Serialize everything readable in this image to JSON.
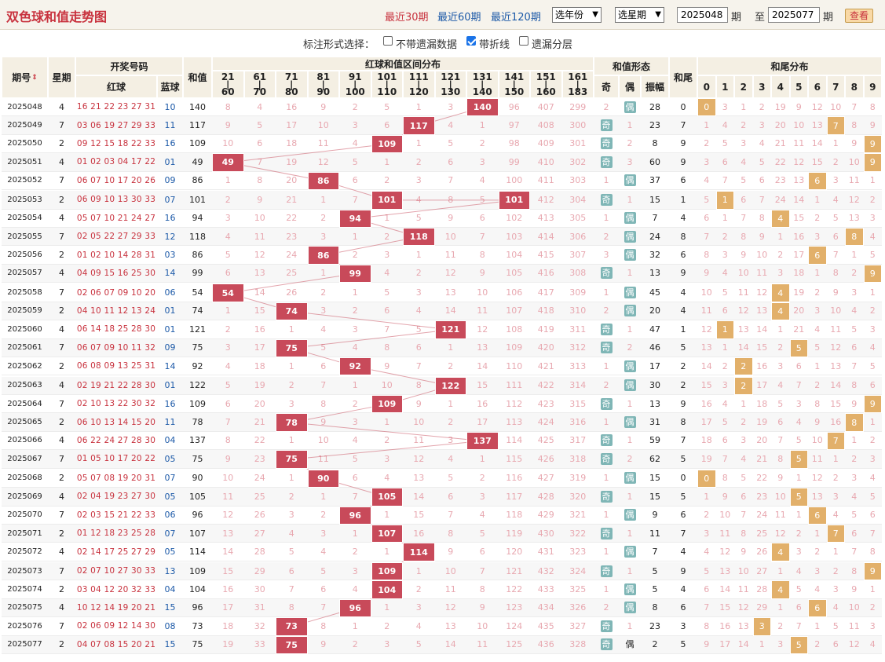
{
  "header": {
    "title": "双色球和值走势图",
    "ranges": [
      "最近30期",
      "最近60期",
      "最近120期"
    ],
    "active_range": 0,
    "year_select": "选年份",
    "week_select": "选星期",
    "from_issue": "2025048",
    "issue_unit": "期",
    "to_label": "至",
    "to_issue": "2025077",
    "view_button": "查看"
  },
  "options": {
    "label": "标注形式选择：",
    "items": [
      {
        "label": "不带遗漏数据",
        "checked": false
      },
      {
        "label": "带折线",
        "checked": true
      },
      {
        "label": "遗漏分层",
        "checked": false
      }
    ]
  },
  "columns": {
    "issue": "期号",
    "weekday": "星期",
    "draw": "开奖号码",
    "red": "红球",
    "blue": "蓝球",
    "sum": "和值",
    "zone_title": "红球和值区间分布",
    "zones": [
      [
        "21",
        "60"
      ],
      [
        "61",
        "70"
      ],
      [
        "71",
        "80"
      ],
      [
        "81",
        "90"
      ],
      [
        "91",
        "100"
      ],
      [
        "101",
        "110"
      ],
      [
        "111",
        "120"
      ],
      [
        "121",
        "130"
      ],
      [
        "131",
        "140"
      ],
      [
        "141",
        "150"
      ],
      [
        "151",
        "160"
      ],
      [
        "161",
        "183"
      ]
    ],
    "form_title": "和值形态",
    "form_cols": [
      "奇",
      "偶",
      "振幅"
    ],
    "tail": "和尾",
    "tail_title": "和尾分布",
    "tail_digits": [
      "0",
      "1",
      "2",
      "3",
      "4",
      "5",
      "6",
      "7",
      "8",
      "9"
    ]
  },
  "colors": {
    "hit": "#c84a5a",
    "tail_hit": "#e2b06a",
    "odd": "#7fb6b6",
    "even": "#7fb6b6",
    "miss": "#e8a8b0",
    "red_ball": "#c8323e",
    "blue_ball": "#1d5aa8"
  },
  "rows": [
    {
      "issue": "2025048",
      "wd": "4",
      "red": "16 21 22 23 27 31",
      "blue": "10",
      "sum": "140",
      "zones": [
        "8",
        "4",
        "16",
        "9",
        "2",
        "5",
        "1",
        "3",
        "140",
        "96",
        "407",
        "299"
      ],
      "forms": [
        "2",
        "偶",
        "28"
      ],
      "tail": "0",
      "tails": [
        "0",
        "3",
        "1",
        "2",
        "19",
        "9",
        "12",
        "10",
        "7",
        "8"
      ]
    },
    {
      "issue": "2025049",
      "wd": "7",
      "red": "03 06 19 27 29 33",
      "blue": "11",
      "sum": "117",
      "zones": [
        "9",
        "5",
        "17",
        "10",
        "3",
        "6",
        "117",
        "4",
        "1",
        "97",
        "408",
        "300"
      ],
      "forms": [
        "奇",
        "1",
        "23"
      ],
      "tail": "7",
      "tails": [
        "1",
        "4",
        "2",
        "3",
        "20",
        "10",
        "13",
        "7",
        "8",
        "9"
      ]
    },
    {
      "issue": "2025050",
      "wd": "2",
      "red": "09 12 15 18 22 33",
      "blue": "16",
      "sum": "109",
      "zones": [
        "10",
        "6",
        "18",
        "11",
        "4",
        "109",
        "1",
        "5",
        "2",
        "98",
        "409",
        "301"
      ],
      "forms": [
        "奇",
        "2",
        "8"
      ],
      "tail": "9",
      "tails": [
        "2",
        "5",
        "3",
        "4",
        "21",
        "11",
        "14",
        "1",
        "9",
        "9"
      ]
    },
    {
      "issue": "2025051",
      "wd": "4",
      "red": "01 02 03 04 17 22",
      "blue": "01",
      "sum": "49",
      "zones": [
        "49",
        "7",
        "19",
        "12",
        "5",
        "1",
        "2",
        "6",
        "3",
        "99",
        "410",
        "302"
      ],
      "forms": [
        "奇",
        "3",
        "60"
      ],
      "tail": "9",
      "tails": [
        "3",
        "6",
        "4",
        "5",
        "22",
        "12",
        "15",
        "2",
        "10",
        "9"
      ]
    },
    {
      "issue": "2025052",
      "wd": "7",
      "red": "06 07 10 17 20 26",
      "blue": "09",
      "sum": "86",
      "zones": [
        "1",
        "8",
        "20",
        "86",
        "6",
        "2",
        "3",
        "7",
        "4",
        "100",
        "411",
        "303"
      ],
      "forms": [
        "1",
        "偶",
        "37"
      ],
      "tail": "6",
      "tails": [
        "4",
        "7",
        "5",
        "6",
        "23",
        "13",
        "6",
        "3",
        "11",
        "1"
      ]
    },
    {
      "issue": "2025053",
      "wd": "2",
      "red": "06 09 10 13 30 33",
      "blue": "07",
      "sum": "101",
      "zones": [
        "2",
        "9",
        "21",
        "1",
        "7",
        "101",
        "4",
        "8",
        "5",
        "101",
        "412",
        "304"
      ],
      "forms": [
        "奇",
        "1",
        "15"
      ],
      "tail": "1",
      "tails": [
        "5",
        "1",
        "6",
        "7",
        "24",
        "14",
        "1",
        "4",
        "12",
        "2"
      ]
    },
    {
      "issue": "2025054",
      "wd": "4",
      "red": "05 07 10 21 24 27",
      "blue": "16",
      "sum": "94",
      "zones": [
        "3",
        "10",
        "22",
        "2",
        "94",
        "1",
        "5",
        "9",
        "6",
        "102",
        "413",
        "305"
      ],
      "forms": [
        "1",
        "偶",
        "7"
      ],
      "tail": "4",
      "tails": [
        "6",
        "1",
        "7",
        "8",
        "4",
        "15",
        "2",
        "5",
        "13",
        "3"
      ]
    },
    {
      "issue": "2025055",
      "wd": "7",
      "red": "02 05 22 27 29 33",
      "blue": "12",
      "sum": "118",
      "zones": [
        "4",
        "11",
        "23",
        "3",
        "1",
        "2",
        "118",
        "10",
        "7",
        "103",
        "414",
        "306"
      ],
      "forms": [
        "2",
        "偶",
        "24"
      ],
      "tail": "8",
      "tails": [
        "7",
        "2",
        "8",
        "9",
        "1",
        "16",
        "3",
        "6",
        "8",
        "4"
      ]
    },
    {
      "issue": "2025056",
      "wd": "2",
      "red": "01 02 10 14 28 31",
      "blue": "03",
      "sum": "86",
      "zones": [
        "5",
        "12",
        "24",
        "86",
        "2",
        "3",
        "1",
        "11",
        "8",
        "104",
        "415",
        "307"
      ],
      "forms": [
        "3",
        "偶",
        "32"
      ],
      "tail": "6",
      "tails": [
        "8",
        "3",
        "9",
        "10",
        "2",
        "17",
        "6",
        "7",
        "1",
        "5"
      ]
    },
    {
      "issue": "2025057",
      "wd": "4",
      "red": "04 09 15 16 25 30",
      "blue": "14",
      "sum": "99",
      "zones": [
        "6",
        "13",
        "25",
        "1",
        "99",
        "4",
        "2",
        "12",
        "9",
        "105",
        "416",
        "308"
      ],
      "forms": [
        "奇",
        "1",
        "13"
      ],
      "tail": "9",
      "tails": [
        "9",
        "4",
        "10",
        "11",
        "3",
        "18",
        "1",
        "8",
        "2",
        "9"
      ]
    },
    {
      "issue": "2025058",
      "wd": "7",
      "red": "02 06 07 09 10 20",
      "blue": "06",
      "sum": "54",
      "zones": [
        "54",
        "14",
        "26",
        "2",
        "1",
        "5",
        "3",
        "13",
        "10",
        "106",
        "417",
        "309"
      ],
      "forms": [
        "1",
        "偶",
        "45"
      ],
      "tail": "4",
      "tails": [
        "10",
        "5",
        "11",
        "12",
        "4",
        "19",
        "2",
        "9",
        "3",
        "1"
      ]
    },
    {
      "issue": "2025059",
      "wd": "2",
      "red": "04 10 11 12 13 24",
      "blue": "01",
      "sum": "74",
      "zones": [
        "1",
        "15",
        "74",
        "3",
        "2",
        "6",
        "4",
        "14",
        "11",
        "107",
        "418",
        "310"
      ],
      "forms": [
        "2",
        "偶",
        "20"
      ],
      "tail": "4",
      "tails": [
        "11",
        "6",
        "12",
        "13",
        "4",
        "20",
        "3",
        "10",
        "4",
        "2"
      ]
    },
    {
      "issue": "2025060",
      "wd": "4",
      "red": "06 14 18 25 28 30",
      "blue": "01",
      "sum": "121",
      "zones": [
        "2",
        "16",
        "1",
        "4",
        "3",
        "7",
        "5",
        "121",
        "12",
        "108",
        "419",
        "311"
      ],
      "forms": [
        "奇",
        "1",
        "47"
      ],
      "tail": "1",
      "tails": [
        "12",
        "1",
        "13",
        "14",
        "1",
        "21",
        "4",
        "11",
        "5",
        "3"
      ]
    },
    {
      "issue": "2025061",
      "wd": "7",
      "red": "06 07 09 10 11 32",
      "blue": "09",
      "sum": "75",
      "zones": [
        "3",
        "17",
        "75",
        "5",
        "4",
        "8",
        "6",
        "1",
        "13",
        "109",
        "420",
        "312"
      ],
      "forms": [
        "奇",
        "2",
        "46"
      ],
      "tail": "5",
      "tails": [
        "13",
        "1",
        "14",
        "15",
        "2",
        "5",
        "5",
        "12",
        "6",
        "4"
      ]
    },
    {
      "issue": "2025062",
      "wd": "2",
      "red": "06 08 09 13 25 31",
      "blue": "14",
      "sum": "92",
      "zones": [
        "4",
        "18",
        "1",
        "6",
        "92",
        "9",
        "7",
        "2",
        "14",
        "110",
        "421",
        "313"
      ],
      "forms": [
        "1",
        "偶",
        "17"
      ],
      "tail": "2",
      "tails": [
        "14",
        "2",
        "2",
        "16",
        "3",
        "6",
        "1",
        "13",
        "7",
        "5"
      ]
    },
    {
      "issue": "2025063",
      "wd": "4",
      "red": "02 19 21 22 28 30",
      "blue": "01",
      "sum": "122",
      "zones": [
        "5",
        "19",
        "2",
        "7",
        "1",
        "10",
        "8",
        "122",
        "15",
        "111",
        "422",
        "314"
      ],
      "forms": [
        "2",
        "偶",
        "30"
      ],
      "tail": "2",
      "tails": [
        "15",
        "3",
        "2",
        "17",
        "4",
        "7",
        "2",
        "14",
        "8",
        "6"
      ]
    },
    {
      "issue": "2025064",
      "wd": "7",
      "red": "02 10 13 22 30 32",
      "blue": "16",
      "sum": "109",
      "zones": [
        "6",
        "20",
        "3",
        "8",
        "2",
        "109",
        "9",
        "1",
        "16",
        "112",
        "423",
        "315"
      ],
      "forms": [
        "奇",
        "1",
        "13"
      ],
      "tail": "9",
      "tails": [
        "16",
        "4",
        "1",
        "18",
        "5",
        "3",
        "8",
        "15",
        "9",
        "9"
      ]
    },
    {
      "issue": "2025065",
      "wd": "2",
      "red": "06 10 13 14 15 20",
      "blue": "11",
      "sum": "78",
      "zones": [
        "7",
        "21",
        "78",
        "9",
        "3",
        "1",
        "10",
        "2",
        "17",
        "113",
        "424",
        "316"
      ],
      "forms": [
        "1",
        "偶",
        "31"
      ],
      "tail": "8",
      "tails": [
        "17",
        "5",
        "2",
        "19",
        "6",
        "4",
        "9",
        "16",
        "8",
        "1"
      ]
    },
    {
      "issue": "2025066",
      "wd": "4",
      "red": "06 22 24 27 28 30",
      "blue": "04",
      "sum": "137",
      "zones": [
        "8",
        "22",
        "1",
        "10",
        "4",
        "2",
        "11",
        "3",
        "137",
        "114",
        "425",
        "317"
      ],
      "forms": [
        "奇",
        "1",
        "59"
      ],
      "tail": "7",
      "tails": [
        "18",
        "6",
        "3",
        "20",
        "7",
        "5",
        "10",
        "7",
        "1",
        "2"
      ]
    },
    {
      "issue": "2025067",
      "wd": "7",
      "red": "01 05 10 17 20 22",
      "blue": "05",
      "sum": "75",
      "zones": [
        "9",
        "23",
        "75",
        "11",
        "5",
        "3",
        "12",
        "4",
        "1",
        "115",
        "426",
        "318"
      ],
      "forms": [
        "奇",
        "2",
        "62"
      ],
      "tail": "5",
      "tails": [
        "19",
        "7",
        "4",
        "21",
        "8",
        "5",
        "11",
        "1",
        "2",
        "3"
      ]
    },
    {
      "issue": "2025068",
      "wd": "2",
      "red": "05 07 08 19 20 31",
      "blue": "07",
      "sum": "90",
      "zones": [
        "10",
        "24",
        "1",
        "90",
        "6",
        "4",
        "13",
        "5",
        "2",
        "116",
        "427",
        "319"
      ],
      "forms": [
        "1",
        "偶",
        "15"
      ],
      "tail": "0",
      "tails": [
        "0",
        "8",
        "5",
        "22",
        "9",
        "1",
        "12",
        "2",
        "3",
        "4"
      ]
    },
    {
      "issue": "2025069",
      "wd": "4",
      "red": "02 04 19 23 27 30",
      "blue": "05",
      "sum": "105",
      "zones": [
        "11",
        "25",
        "2",
        "1",
        "7",
        "105",
        "14",
        "6",
        "3",
        "117",
        "428",
        "320"
      ],
      "forms": [
        "奇",
        "1",
        "15"
      ],
      "tail": "5",
      "tails": [
        "1",
        "9",
        "6",
        "23",
        "10",
        "5",
        "13",
        "3",
        "4",
        "5"
      ]
    },
    {
      "issue": "2025070",
      "wd": "7",
      "red": "02 03 15 21 22 33",
      "blue": "06",
      "sum": "96",
      "zones": [
        "12",
        "26",
        "3",
        "2",
        "96",
        "1",
        "15",
        "7",
        "4",
        "118",
        "429",
        "321"
      ],
      "forms": [
        "1",
        "偶",
        "9"
      ],
      "tail": "6",
      "tails": [
        "2",
        "10",
        "7",
        "24",
        "11",
        "1",
        "6",
        "4",
        "5",
        "6"
      ]
    },
    {
      "issue": "2025071",
      "wd": "2",
      "red": "01 12 18 23 25 28",
      "blue": "07",
      "sum": "107",
      "zones": [
        "13",
        "27",
        "4",
        "3",
        "1",
        "107",
        "16",
        "8",
        "5",
        "119",
        "430",
        "322"
      ],
      "forms": [
        "奇",
        "1",
        "11"
      ],
      "tail": "7",
      "tails": [
        "3",
        "11",
        "8",
        "25",
        "12",
        "2",
        "1",
        "7",
        "6",
        "7"
      ]
    },
    {
      "issue": "2025072",
      "wd": "4",
      "red": "02 14 17 25 27 29",
      "blue": "05",
      "sum": "114",
      "zones": [
        "14",
        "28",
        "5",
        "4",
        "2",
        "1",
        "114",
        "9",
        "6",
        "120",
        "431",
        "323"
      ],
      "forms": [
        "1",
        "偶",
        "7"
      ],
      "tail": "4",
      "tails": [
        "4",
        "12",
        "9",
        "26",
        "4",
        "3",
        "2",
        "1",
        "7",
        "8"
      ]
    },
    {
      "issue": "2025073",
      "wd": "7",
      "red": "02 07 10 27 30 33",
      "blue": "13",
      "sum": "109",
      "zones": [
        "15",
        "29",
        "6",
        "5",
        "3",
        "109",
        "1",
        "10",
        "7",
        "121",
        "432",
        "324"
      ],
      "forms": [
        "奇",
        "1",
        "5"
      ],
      "tail": "9",
      "tails": [
        "5",
        "13",
        "10",
        "27",
        "1",
        "4",
        "3",
        "2",
        "8",
        "9"
      ]
    },
    {
      "issue": "2025074",
      "wd": "2",
      "red": "03 04 12 20 32 33",
      "blue": "04",
      "sum": "104",
      "zones": [
        "16",
        "30",
        "7",
        "6",
        "4",
        "104",
        "2",
        "11",
        "8",
        "122",
        "433",
        "325"
      ],
      "forms": [
        "1",
        "偶",
        "5"
      ],
      "tail": "4",
      "tails": [
        "6",
        "14",
        "11",
        "28",
        "4",
        "5",
        "4",
        "3",
        "9",
        "1"
      ]
    },
    {
      "issue": "2025075",
      "wd": "4",
      "red": "10 12 14 19 20 21",
      "blue": "15",
      "sum": "96",
      "zones": [
        "17",
        "31",
        "8",
        "7",
        "96",
        "1",
        "3",
        "12",
        "9",
        "123",
        "434",
        "326"
      ],
      "forms": [
        "2",
        "偶",
        "8"
      ],
      "tail": "6",
      "tails": [
        "7",
        "15",
        "12",
        "29",
        "1",
        "6",
        "6",
        "4",
        "10",
        "2"
      ]
    },
    {
      "issue": "2025076",
      "wd": "7",
      "red": "02 06 09 12 14 30",
      "blue": "08",
      "sum": "73",
      "zones": [
        "18",
        "32",
        "73",
        "8",
        "1",
        "2",
        "4",
        "13",
        "10",
        "124",
        "435",
        "327"
      ],
      "forms": [
        "奇",
        "1",
        "23"
      ],
      "tail": "3",
      "tails": [
        "8",
        "16",
        "13",
        "3",
        "2",
        "7",
        "1",
        "5",
        "11",
        "3"
      ]
    },
    {
      "issue": "2025077",
      "wd": "2",
      "red": "04 07 08 15 20 21",
      "blue": "15",
      "sum": "75",
      "zones": [
        "19",
        "33",
        "75",
        "9",
        "2",
        "3",
        "5",
        "14",
        "11",
        "125",
        "436",
        "328"
      ],
      "forms": [
        "奇",
        "偶",
        "2"
      ],
      "tail": "5",
      "tails": [
        "9",
        "17",
        "14",
        "1",
        "3",
        "5",
        "2",
        "6",
        "12",
        "4"
      ]
    }
  ]
}
